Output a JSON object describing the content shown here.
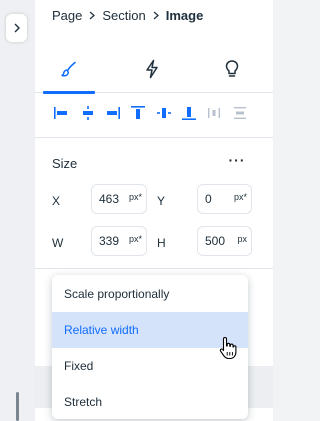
{
  "breadcrumb": {
    "items": [
      "Page",
      "Section",
      "Image"
    ]
  },
  "tabs": [
    {
      "name": "design",
      "icon": "brush-icon",
      "active": true
    },
    {
      "name": "interactions",
      "icon": "lightning-icon",
      "active": false
    },
    {
      "name": "tips",
      "icon": "lightbulb-icon",
      "active": false
    }
  ],
  "align_tools": [
    "align-left-icon",
    "align-center-horizontal-icon",
    "align-right-icon",
    "align-top-icon",
    "align-middle-vertical-icon",
    "align-bottom-icon",
    "distribute-horizontal-icon",
    "distribute-vertical-icon"
  ],
  "size": {
    "title": "Size",
    "more_label": "···",
    "x": {
      "label": "X",
      "value": "463",
      "unit": "px*"
    },
    "y": {
      "label": "Y",
      "value": "0",
      "unit": "px*"
    },
    "w": {
      "label": "W",
      "value": "339",
      "unit": "px*"
    },
    "h": {
      "label": "H",
      "value": "500",
      "unit": "px"
    }
  },
  "dropdown": {
    "options": [
      "Scale proportionally",
      "Relative width",
      "Fixed",
      "Stretch"
    ],
    "selected": "Relative width"
  },
  "colors": {
    "accent": "#116dff",
    "selected_bg": "#d5e3fa",
    "text": "#20303c",
    "border": "#dfe5eb",
    "disabled": "#b6c1cd"
  }
}
